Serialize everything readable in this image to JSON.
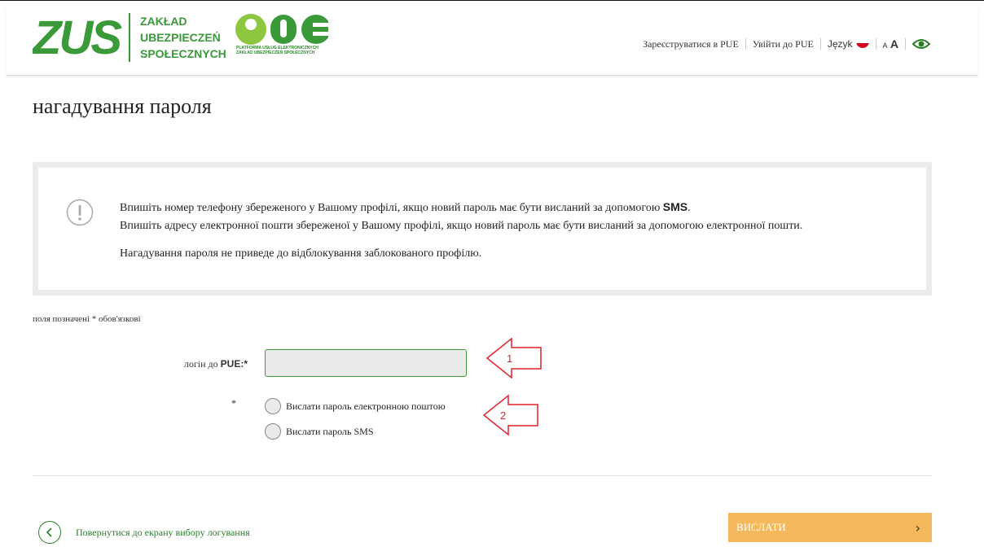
{
  "header": {
    "zus_logo_text": "ZUS",
    "org_name_lines": [
      "ZAKŁAD",
      "UBEZPIECZEŃ",
      "SPOŁECZNYCH"
    ],
    "pue_logo_text": "PUE",
    "pue_subtitle_lines": [
      "PLATFORMA USŁUG ELEKTRONICZNYCH",
      "ZAKŁAD UBEZPIECZEŃ SPOŁECZNYCH"
    ],
    "register_label": "Зареєструватися в PUE",
    "login_label": "Увійти до PUE",
    "language_label": "Język",
    "font_small": "A",
    "font_large": "A",
    "brand_color": "#3a9a3a"
  },
  "page_title": "нагадування пароля",
  "info": {
    "icon": "exclamation-circle-icon",
    "line1_prefix": "Впишіть номер телефону збереженого у Вашому профілі, якщо новий пароль має бути висланий за допомогою",
    "line1_bold": "SMS",
    "line1_suffix": ".",
    "line2": "Впишіть адресу електронної пошти збереженої у Вашому профілі, якщо новий пароль має бути висланий за допомогою електронної пошти.",
    "line3": "Нагадування пароля не приведе до відблокування заблокованого профілю."
  },
  "form": {
    "required_note": "поля позначені * обов'язкові",
    "login_label_prefix": "логін до",
    "login_label_bold": "PUE:*",
    "login_value": "",
    "radio_star": "*",
    "options": [
      {
        "label": "Вислати пароль електронною поштою",
        "selected": false
      },
      {
        "label": "Вислати пароль SMS",
        "selected": false
      }
    ]
  },
  "annotations": {
    "arrow1": "1",
    "arrow2": "2",
    "color": "#e0202a"
  },
  "footer": {
    "back_label": "Повернутися до екрану вибору логування",
    "send_label": "ВИСЛАТИ",
    "send_color": "#f5b85c"
  }
}
